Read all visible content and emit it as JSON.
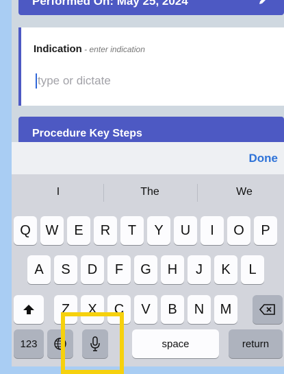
{
  "header": {
    "banner_text": "Performed On: May 25, 2024"
  },
  "indication": {
    "title": "Indication",
    "hint": " - enter indication",
    "placeholder": "type or dictate"
  },
  "procedure": {
    "title": "Procedure Key Steps"
  },
  "keyboard_toolbar": {
    "done_label": "Done"
  },
  "suggestions": [
    "I",
    "The",
    "We"
  ],
  "keyboard": {
    "row1": [
      "Q",
      "W",
      "E",
      "R",
      "T",
      "Y",
      "U",
      "I",
      "O",
      "P"
    ],
    "row2": [
      "A",
      "S",
      "D",
      "F",
      "G",
      "H",
      "J",
      "K",
      "L"
    ],
    "row3": [
      "Z",
      "X",
      "C",
      "V",
      "B",
      "N",
      "M"
    ],
    "numbers_label": "123",
    "space_label": "space",
    "return_label": "return"
  },
  "colors": {
    "accent": "#4d59c3",
    "done_blue": "#2f73d8",
    "highlight": "#f6d10d"
  },
  "icons": [
    "edit-icon",
    "shift-icon",
    "globe-icon",
    "microphone-icon",
    "backspace-icon"
  ]
}
